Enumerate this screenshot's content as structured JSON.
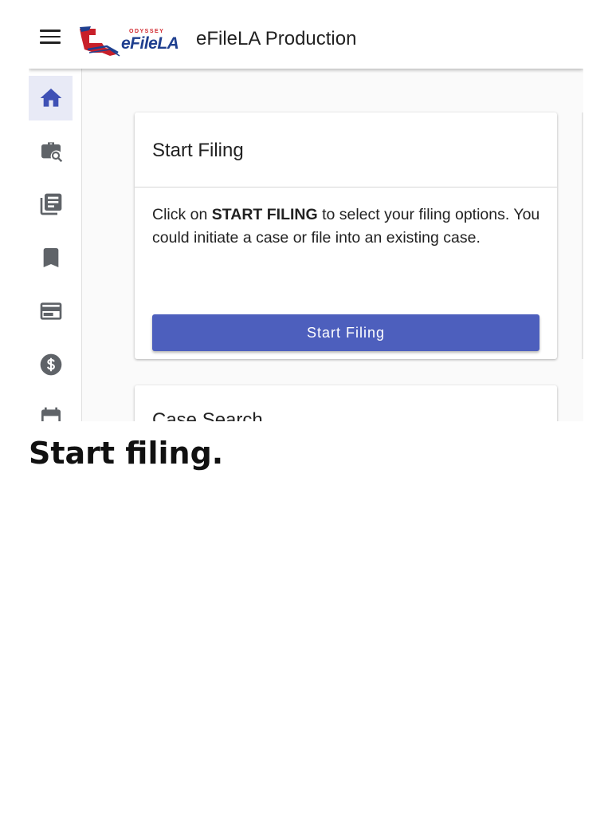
{
  "header": {
    "logo": {
      "subtitle": "ODYSSEY",
      "wordmark": "eFileLA",
      "icon": "louisiana-state-logo"
    },
    "title": "eFileLA Production",
    "menu_icon": "hamburger-menu-icon"
  },
  "sidebar": {
    "items": [
      {
        "icon": "home-icon",
        "active": true
      },
      {
        "icon": "case-search-icon",
        "active": false
      },
      {
        "icon": "document-icon",
        "active": false
      },
      {
        "icon": "bookmark-icon",
        "active": false
      },
      {
        "icon": "card-icon",
        "active": false
      },
      {
        "icon": "dollar-icon",
        "active": false
      },
      {
        "icon": "calendar-icon",
        "active": false
      }
    ]
  },
  "main": {
    "start_card": {
      "title": "Start Filing",
      "body_prefix": "Click on ",
      "body_bold": "START FILING",
      "body_suffix": " to select your filing options. You could initiate a case or file into an existing case.",
      "button_label": "Start Filing"
    },
    "search_card": {
      "title": "Case Search"
    }
  },
  "caption": "Start filing.",
  "colors": {
    "primary": "#4d5fbd",
    "active_nav": "#e8eaf6",
    "icon": "#5f6368",
    "active_icon": "#3f51b5"
  }
}
